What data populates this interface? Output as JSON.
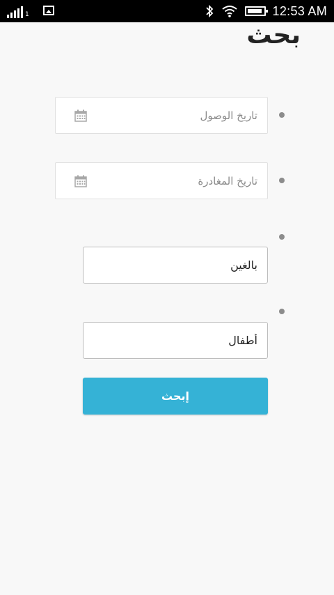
{
  "status_bar": {
    "sim_slot": "1",
    "time": "12:53 AM"
  },
  "page": {
    "title": "بحث"
  },
  "form": {
    "arrival_date": {
      "placeholder": "تاريخ الوصول",
      "icon": "calendar-icon"
    },
    "departure_date": {
      "placeholder": "تاريخ المغادرة",
      "icon": "calendar-icon"
    },
    "adults": {
      "placeholder": "بالغين"
    },
    "children": {
      "placeholder": "أطفال"
    },
    "search_label": "إبحث"
  },
  "colors": {
    "accent": "#35b2d6",
    "background": "#f8f8f8",
    "bullet": "#8c8c8c"
  }
}
